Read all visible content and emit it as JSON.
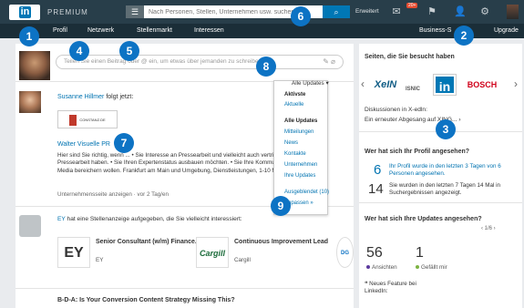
{
  "header": {
    "logo_text": "Linked",
    "logo_in": "in",
    "premium": "PREMIUM",
    "menu_icon": "hamburger-icon",
    "search_placeholder": "Nach Personen, Stellen, Unternehmen usw. suchen",
    "search_icon": "search-icon",
    "advanced": "Erweitert",
    "mail_badge": "20+"
  },
  "nav": {
    "items": [
      "Profil",
      "Netzwerk",
      "Stellenmarkt",
      "Interessen"
    ],
    "right": [
      "Business-S",
      "Upgrade"
    ]
  },
  "share": {
    "placeholder": "Teilen Sie einen Beitrag oder @ ein, um etwas über jemanden zu schreiben"
  },
  "feed": {
    "update1": {
      "name": "Susanne Hillmer",
      "action": "folgt jetzt:",
      "company_logo_text": "CONSTANZ.DE",
      "company": "Walter Visuelle PR",
      "body": "Hier sind Sie richtig, wenn ... • Sie Interesse an Pressearbeit und vielleicht auch vertriebsunterstützender Pressearbeit haben. • Sie Ihren Expertenstatus ausbauen möchten. • Sie Ihre Kommunikation um Social Media bereichern wollen. Frankfurt am Main und Umgebung, Dienstleistungen, 1-10 Mitarbeiter",
      "meta": "Unternehmensseite anzeigen · vor 2 Tag/en"
    },
    "update2": {
      "company": "EY",
      "text": "hat eine Stellenanzeige aufgegeben, die Sie vielleicht interessiert:",
      "jobs": [
        {
          "logo": "EY",
          "title": "Senior Consultant (w/m) Finance...",
          "company": "EY"
        },
        {
          "logo": "Cargill",
          "title": "Continuous Improvement Lead",
          "company": "Cargill"
        },
        {
          "logo": "DG",
          "title": "",
          "company": ""
        }
      ]
    },
    "update3": {
      "title": "B-D-A: Is Your Conversion Content Strategy Missing This?"
    }
  },
  "dropdown": {
    "selected": "Alle Updates",
    "items": [
      "Aktivste",
      "Aktuelle",
      "Alle Updates",
      "Mitteilungen",
      "News",
      "Kontakte",
      "Unternehmen",
      "Ihre Updates",
      "Ausgeblendet (10)",
      "Anpassen »"
    ]
  },
  "sidebar": {
    "pages_title": "Seiten, die Sie besucht haben",
    "logos": [
      "XeIN",
      "ISNIC",
      "in",
      "BOSCH"
    ],
    "discussions": "Diskussionen in X-edln:",
    "discussion_item": "Ein erneuter Abgesang auf XING... ›",
    "viewed_title": "Wer hat sich Ihr Profil angesehen?",
    "viewed_stats": [
      {
        "num": "6",
        "text": "Ihr Profil wurde in den letzten 3 Tagen von 6 Personen angesehen."
      },
      {
        "num": "14",
        "text": "Sie wurden in den letzten 7 Tagen 14 Mal in Suchergebnissen angezeigt."
      }
    ],
    "updates_title": "Wer hat sich Ihre Updates angesehen?",
    "pager": "‹ 1/6 ›",
    "views": "56",
    "views_label": "Ansichten",
    "likes": "1",
    "likes_label": "Gefällt mir",
    "neues_feature": "Neues Feature bei LinkedIn:"
  },
  "annotations": [
    "1",
    "2",
    "3",
    "4",
    "5",
    "6",
    "7",
    "8",
    "9"
  ],
  "colors": {
    "topbar": "#283e4a",
    "brand": "#0077b5",
    "annotation": "#0d73c4"
  }
}
